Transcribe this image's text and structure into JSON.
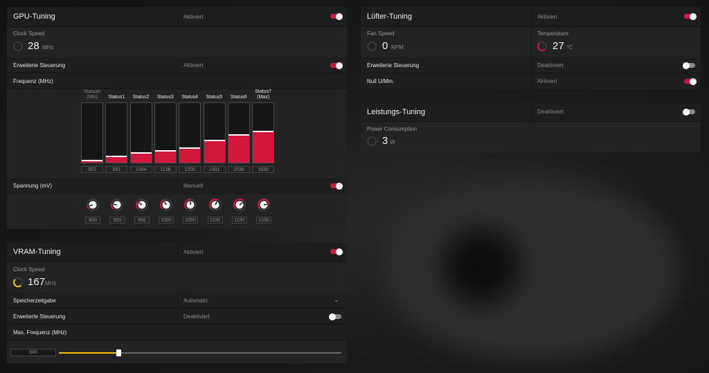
{
  "colors": {
    "accent": "#d3183b",
    "vram_gauge": "#f2c200",
    "panel": "#232323"
  },
  "gpu": {
    "title": "GPU-Tuning",
    "status": "Aktiviert",
    "enabled": true,
    "clock_label": "Clock Speed",
    "clock_value": "28",
    "clock_unit": "MHz",
    "advanced_label": "Erweiterte Steuerung",
    "advanced_status": "Aktiviert",
    "advanced_enabled": true,
    "freq_label": "Frequenz (MHz)",
    "states": [
      {
        "l1": "Status0",
        "l2": "(Min)",
        "value": "852",
        "level": 0.02
      },
      {
        "l1": "Status1",
        "l2": "",
        "value": "991",
        "level": 0.09
      },
      {
        "l1": "Status2",
        "l2": "",
        "value": "1084",
        "level": 0.15
      },
      {
        "l1": "Status3",
        "l2": "",
        "value": "1138",
        "level": 0.19
      },
      {
        "l1": "Status4",
        "l2": "",
        "value": "1200",
        "level": 0.23
      },
      {
        "l1": "Status5",
        "l2": "",
        "value": "1401",
        "level": 0.36
      },
      {
        "l1": "Status6",
        "l2": "",
        "value": "1536",
        "level": 0.45
      },
      {
        "l1": "Status7",
        "l2": "(Max)",
        "value": "1630",
        "level": 0.51
      }
    ],
    "voltage_label": "Spannung (mV)",
    "voltage_status": "Manuell",
    "voltage_enabled": true,
    "voltages": [
      "800",
      "900",
      "950",
      "1000",
      "1050",
      "1100",
      "1150",
      "1200"
    ]
  },
  "vram": {
    "title": "VRAM-Tuning",
    "status": "Aktiviert",
    "enabled": true,
    "clock_label": "Clock Speed",
    "clock_value": "167",
    "clock_unit": "MHz",
    "timing_label": "Speicherzeitgabe",
    "timing_value": "Automatic",
    "advanced_label": "Erweiterte Steuerung",
    "advanced_status": "Deaktiviert",
    "advanced_enabled": false,
    "maxfreq_label": "Max. Frequenz (MHz)",
    "maxfreq_value": "945",
    "slider_fraction": 0.21
  },
  "fan": {
    "title": "Lüfter-Tuning",
    "status": "Aktiviert",
    "enabled": true,
    "speed_label": "Fan Speed",
    "speed_value": "0",
    "speed_unit": "RPM",
    "temp_label": "Temperature",
    "temp_value": "27",
    "temp_unit": "°C",
    "advanced_label": "Erweiterte Steuerung",
    "advanced_status": "Deaktiviert",
    "advanced_enabled": false,
    "zero_label": "Null U/Min.",
    "zero_status": "Aktiviert",
    "zero_enabled": true
  },
  "power": {
    "title": "Leistungs-Tuning",
    "status": "Deaktiviert",
    "enabled": false,
    "consumption_label": "Power Consumption",
    "consumption_value": "3",
    "consumption_unit": "W"
  }
}
